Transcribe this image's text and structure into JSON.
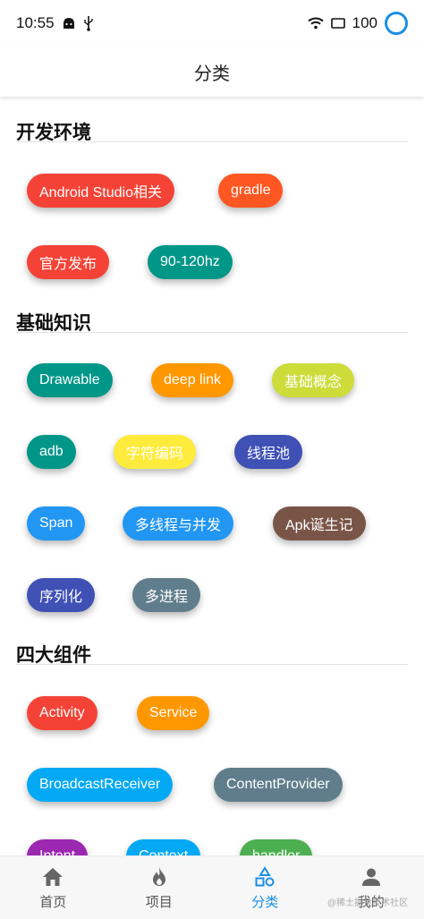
{
  "status": {
    "time": "10:55",
    "battery": "100"
  },
  "header": {
    "title": "分类"
  },
  "sections": [
    {
      "title": "开发环境",
      "chips": [
        {
          "label": "Android Studio相关",
          "color": "#f44336"
        },
        {
          "label": "gradle",
          "color": "#ff5722"
        },
        {
          "label": "官方发布",
          "color": "#f44336"
        },
        {
          "label": "90-120hz",
          "color": "#009688"
        }
      ]
    },
    {
      "title": "基础知识",
      "chips": [
        {
          "label": "Drawable",
          "color": "#009688"
        },
        {
          "label": "deep link",
          "color": "#ff9800"
        },
        {
          "label": "基础概念",
          "color": "#cddc39"
        },
        {
          "label": "adb",
          "color": "#009688"
        },
        {
          "label": "字符编码",
          "color": "#ffeb3b"
        },
        {
          "label": "线程池",
          "color": "#3f51b5"
        },
        {
          "label": "Span",
          "color": "#2196f3"
        },
        {
          "label": "多线程与并发",
          "color": "#2196f3"
        },
        {
          "label": "Apk诞生记",
          "color": "#795548"
        },
        {
          "label": "序列化",
          "color": "#3f51b5"
        },
        {
          "label": "多进程",
          "color": "#607d8b"
        }
      ]
    },
    {
      "title": "四大组件",
      "chips": [
        {
          "label": "Activity",
          "color": "#f44336"
        },
        {
          "label": "Service",
          "color": "#ff9800"
        },
        {
          "label": "BroadcastReceiver",
          "color": "#03a9f4"
        },
        {
          "label": "ContentProvider",
          "color": "#607d8b"
        },
        {
          "label": "Intent",
          "color": "#9c27b0"
        },
        {
          "label": "Context",
          "color": "#03a9f4"
        },
        {
          "label": "handler",
          "color": "#4caf50"
        }
      ]
    }
  ],
  "nav": {
    "items": [
      {
        "label": "首页",
        "icon": "home-icon"
      },
      {
        "label": "项目",
        "icon": "fire-icon"
      },
      {
        "label": "分类",
        "icon": "category-icon",
        "active": true
      },
      {
        "label": "我的",
        "icon": "person-icon"
      }
    ]
  },
  "watermark": "@稀土掘金技术社区",
  "colors": {
    "accent": "#1a8fe3"
  }
}
